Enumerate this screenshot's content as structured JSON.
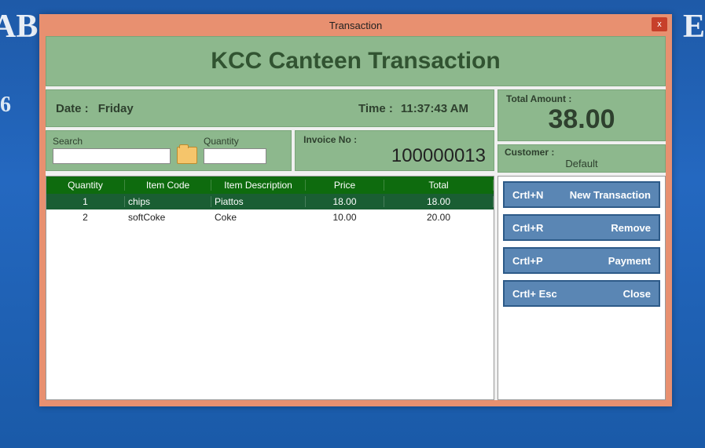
{
  "background": {
    "left_number": "6"
  },
  "window": {
    "title": "Transaction",
    "close_glyph": "x"
  },
  "banner": {
    "title": "KCC Canteen Transaction"
  },
  "datetime": {
    "date_label": "Date :",
    "day": "Friday",
    "time_label": "Time :",
    "time": "11:37:43 AM"
  },
  "search": {
    "search_label": "Search",
    "search_value": "",
    "quantity_label": "Quantity",
    "quantity_value": ""
  },
  "invoice": {
    "label": "Invoice No :",
    "number": "100000013"
  },
  "total": {
    "label": "Total Amount :",
    "value": "38.00"
  },
  "customer": {
    "label": "Customer :",
    "value": "Default"
  },
  "grid": {
    "columns": [
      "Quantity",
      "Item Code",
      "Item Description",
      "Price",
      "Total"
    ],
    "rows": [
      {
        "qty": "1",
        "code": "chips",
        "desc": "Piattos",
        "price": "18.00",
        "total": "18.00",
        "selected": true
      },
      {
        "qty": "2",
        "code": "softCoke",
        "desc": "Coke",
        "price": "10.00",
        "total": "20.00",
        "selected": false
      }
    ]
  },
  "actions": [
    {
      "shortcut": "Crtl+N",
      "label": "New Transaction"
    },
    {
      "shortcut": "Crtl+R",
      "label": "Remove"
    },
    {
      "shortcut": "Crtl+P",
      "label": "Payment"
    },
    {
      "shortcut": "Crtl+ Esc",
      "label": "Close"
    }
  ],
  "colors": {
    "titlebar": "#e89070",
    "panel": "#8db88d",
    "grid_header": "#0e6b0e",
    "row_selected": "#1a5e33",
    "action_btn": "#5a86b4"
  }
}
